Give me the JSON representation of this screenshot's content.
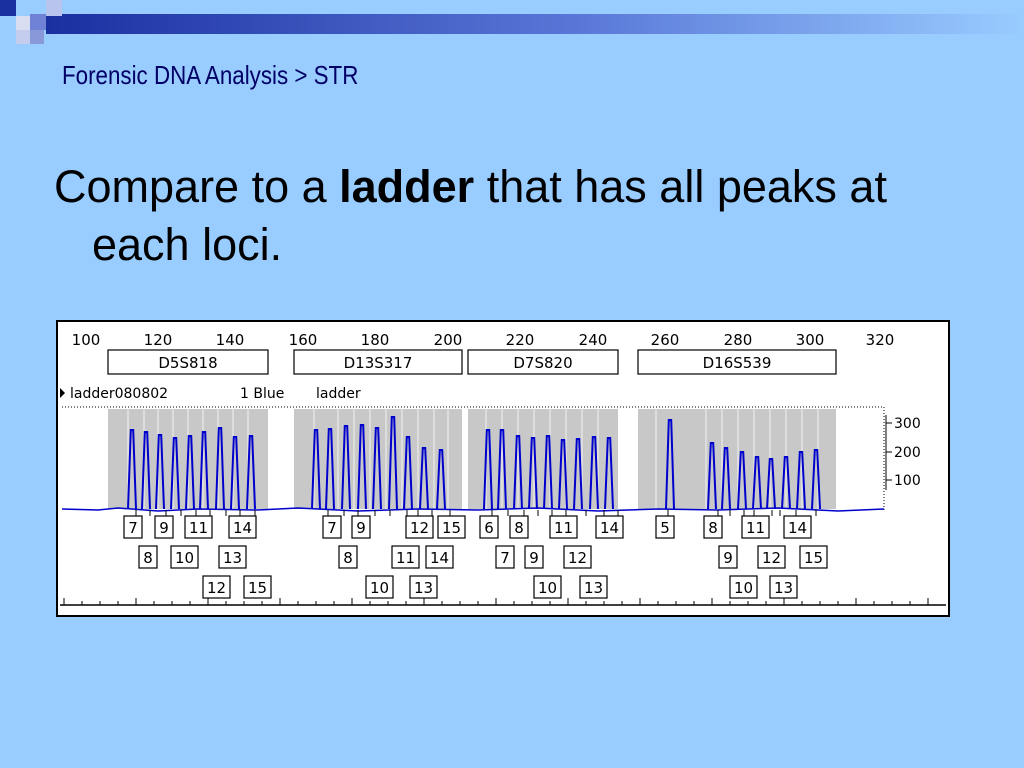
{
  "slide": {
    "breadcrumb": "Forensic DNA Analysis > STR",
    "text_part1": "Compare to a ",
    "text_bold": "ladder",
    "text_part2": " that has all peaks at each loci."
  },
  "figure": {
    "size_ticks": [
      "100",
      "120",
      "140",
      "160",
      "180",
      "200",
      "220",
      "240",
      "260",
      "280",
      "300",
      "320"
    ],
    "loci": [
      {
        "name": "D5S818",
        "alleles": [
          "7",
          "8",
          "9",
          "10",
          "11",
          "12",
          "13",
          "14",
          "15"
        ]
      },
      {
        "name": "D13S317",
        "alleles": [
          "7",
          "8",
          "9",
          "10",
          "11",
          "12",
          "13",
          "14",
          "15"
        ]
      },
      {
        "name": "D7S820",
        "alleles": [
          "6",
          "7",
          "8",
          "9",
          "10",
          "11",
          "12",
          "13",
          "14"
        ]
      },
      {
        "name": "D16S539",
        "alleles": [
          "5",
          "8",
          "9",
          "10",
          "11",
          "12",
          "13",
          "14",
          "15"
        ]
      }
    ],
    "sample_header": {
      "sample": "ladder080802",
      "dye": "1 Blue",
      "type": "ladder"
    },
    "rfu_ticks": [
      "300",
      "200",
      "100"
    ]
  },
  "colors": {
    "background": "#99ccff",
    "peak": "#0000cc",
    "bin": "#c8c8c8",
    "title": "#000066"
  }
}
